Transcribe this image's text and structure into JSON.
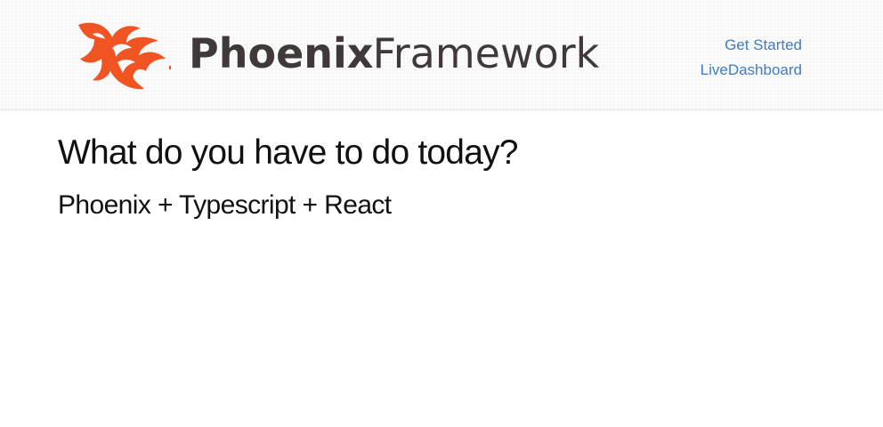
{
  "header": {
    "logo": {
      "brand_bold": "Phoenix",
      "brand_light": " Framework",
      "icon": "phoenix-bird-icon",
      "color": "#f05423"
    },
    "nav": [
      {
        "label": "Get Started"
      },
      {
        "label": "LiveDashboard"
      }
    ],
    "link_color": "#3c7ec7"
  },
  "main": {
    "title": "What do you have to do today?",
    "subtitle": "Phoenix + Typescript + React"
  }
}
